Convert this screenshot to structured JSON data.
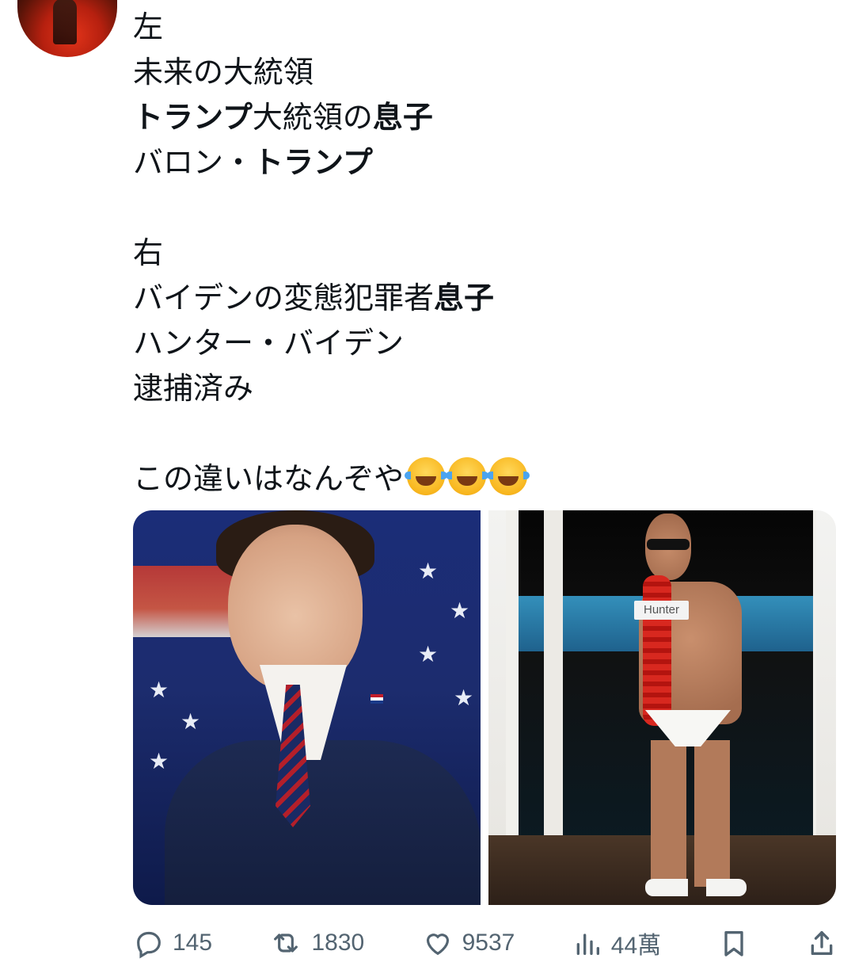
{
  "avatar": {
    "icon": "user-avatar-icon"
  },
  "tweet": {
    "lines": [
      {
        "segments": [
          {
            "text": "左",
            "bold": false
          }
        ]
      },
      {
        "segments": [
          {
            "text": "未来の大統領",
            "bold": false
          }
        ]
      },
      {
        "segments": [
          {
            "text": "トランプ",
            "bold": true
          },
          {
            "text": "大統領の",
            "bold": false
          },
          {
            "text": "息子",
            "bold": true
          }
        ]
      },
      {
        "segments": [
          {
            "text": "バロン・",
            "bold": false
          },
          {
            "text": "トランプ",
            "bold": true
          }
        ]
      },
      {
        "gap": true
      },
      {
        "segments": [
          {
            "text": "右",
            "bold": false
          }
        ]
      },
      {
        "segments": [
          {
            "text": "バイデンの変態犯罪者",
            "bold": false
          },
          {
            "text": "息子",
            "bold": true
          }
        ]
      },
      {
        "segments": [
          {
            "text": "ハンター・バイデン",
            "bold": false
          }
        ]
      },
      {
        "segments": [
          {
            "text": "逮捕済み",
            "bold": false
          }
        ]
      },
      {
        "gap": true
      },
      {
        "segments": [
          {
            "text": "この違いはなんぞや",
            "bold": false
          }
        ],
        "emoji_count": 3
      }
    ],
    "emoji": {
      "name": "face-with-tears-of-joy-icon"
    }
  },
  "media": {
    "left_photo": {
      "name": "photo-left"
    },
    "right_photo": {
      "name": "photo-right",
      "tag": "Hunter"
    }
  },
  "actions": {
    "reply": {
      "icon": "reply-icon",
      "count": "145"
    },
    "repost": {
      "icon": "repost-icon",
      "count": "1830"
    },
    "like": {
      "icon": "heart-icon",
      "count": "9537"
    },
    "views": {
      "icon": "views-icon",
      "count": "44萬"
    },
    "bookmark": {
      "icon": "bookmark-icon"
    },
    "share": {
      "icon": "share-icon"
    }
  },
  "colors": {
    "text": "#0f1419",
    "muted": "#536471"
  }
}
